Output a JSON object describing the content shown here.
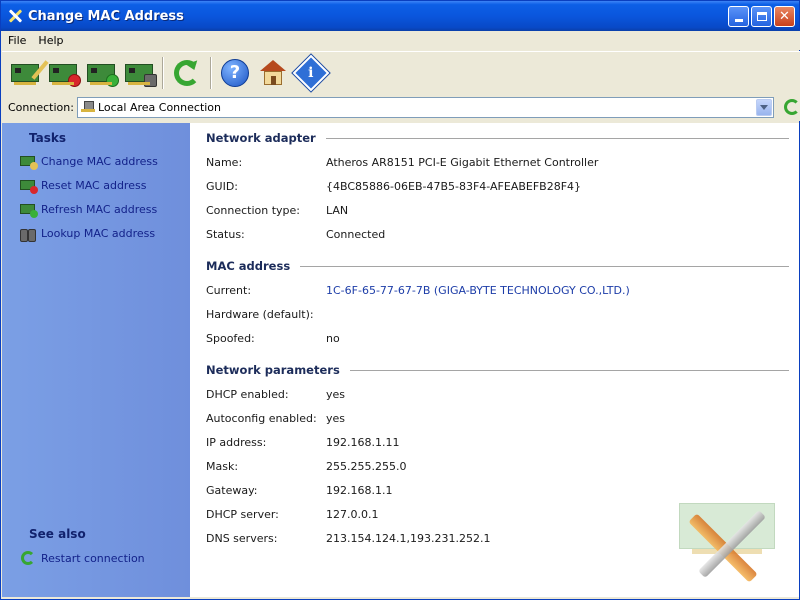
{
  "window": {
    "title": "Change MAC Address"
  },
  "menu": [
    "File",
    "Help"
  ],
  "connection": {
    "label": "Connection:",
    "value": "Local Area Connection"
  },
  "sidebar": {
    "tasks_heading": "Tasks",
    "tasks": [
      {
        "label": "Change MAC address",
        "icon": "card-edit-icon"
      },
      {
        "label": "Reset MAC address",
        "icon": "card-reset-icon"
      },
      {
        "label": "Refresh MAC address",
        "icon": "card-refresh-icon"
      },
      {
        "label": "Lookup MAC address",
        "icon": "binoculars-icon"
      }
    ],
    "see_also_heading": "See also",
    "see_also": [
      {
        "label": "Restart connection",
        "icon": "restart-icon"
      }
    ]
  },
  "sections": {
    "adapter": {
      "title": "Network adapter",
      "rows": [
        {
          "key": "Name:",
          "value": "Atheros AR8151 PCI-E Gigabit Ethernet Controller"
        },
        {
          "key": "GUID:",
          "value": "{4BC85886-06EB-47B5-83F4-AFEABEFB28F4}"
        },
        {
          "key": "Connection type:",
          "value": "LAN"
        },
        {
          "key": "Status:",
          "value": "Connected"
        }
      ]
    },
    "mac": {
      "title": "MAC address",
      "rows": [
        {
          "key": "Current:",
          "value": "1C-6F-65-77-67-7B (GIGA-BYTE TECHNOLOGY CO.,LTD.)"
        },
        {
          "key": "Hardware (default):",
          "value": ""
        },
        {
          "key": "Spoofed:",
          "value": "no"
        }
      ]
    },
    "params": {
      "title": "Network parameters",
      "rows": [
        {
          "key": "DHCP enabled:",
          "value": "yes"
        },
        {
          "key": "Autoconfig enabled:",
          "value": "yes"
        },
        {
          "key": "IP address:",
          "value": "192.168.1.11"
        },
        {
          "key": "Mask:",
          "value": "255.255.255.0"
        },
        {
          "key": "Gateway:",
          "value": "192.168.1.1"
        },
        {
          "key": "DHCP server:",
          "value": "127.0.0.1"
        },
        {
          "key": "DNS servers:",
          "value": "213.154.124.1,193.231.252.1"
        }
      ]
    }
  },
  "colors": {
    "titlebar": "#0a56dd",
    "sidebar": "#7b9fe5",
    "link": "#1d3da8"
  }
}
